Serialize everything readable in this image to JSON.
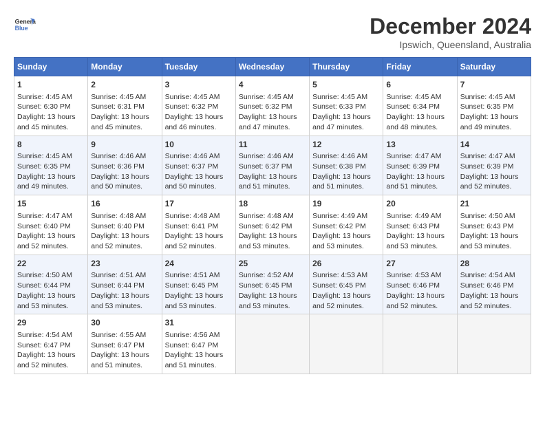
{
  "header": {
    "logo_line1": "General",
    "logo_line2": "Blue",
    "month": "December 2024",
    "location": "Ipswich, Queensland, Australia"
  },
  "weekdays": [
    "Sunday",
    "Monday",
    "Tuesday",
    "Wednesday",
    "Thursday",
    "Friday",
    "Saturday"
  ],
  "weeks": [
    [
      {
        "day": "1",
        "info": "Sunrise: 4:45 AM\nSunset: 6:30 PM\nDaylight: 13 hours\nand 45 minutes."
      },
      {
        "day": "2",
        "info": "Sunrise: 4:45 AM\nSunset: 6:31 PM\nDaylight: 13 hours\nand 45 minutes."
      },
      {
        "day": "3",
        "info": "Sunrise: 4:45 AM\nSunset: 6:32 PM\nDaylight: 13 hours\nand 46 minutes."
      },
      {
        "day": "4",
        "info": "Sunrise: 4:45 AM\nSunset: 6:32 PM\nDaylight: 13 hours\nand 47 minutes."
      },
      {
        "day": "5",
        "info": "Sunrise: 4:45 AM\nSunset: 6:33 PM\nDaylight: 13 hours\nand 47 minutes."
      },
      {
        "day": "6",
        "info": "Sunrise: 4:45 AM\nSunset: 6:34 PM\nDaylight: 13 hours\nand 48 minutes."
      },
      {
        "day": "7",
        "info": "Sunrise: 4:45 AM\nSunset: 6:35 PM\nDaylight: 13 hours\nand 49 minutes."
      }
    ],
    [
      {
        "day": "8",
        "info": "Sunrise: 4:45 AM\nSunset: 6:35 PM\nDaylight: 13 hours\nand 49 minutes."
      },
      {
        "day": "9",
        "info": "Sunrise: 4:46 AM\nSunset: 6:36 PM\nDaylight: 13 hours\nand 50 minutes."
      },
      {
        "day": "10",
        "info": "Sunrise: 4:46 AM\nSunset: 6:37 PM\nDaylight: 13 hours\nand 50 minutes."
      },
      {
        "day": "11",
        "info": "Sunrise: 4:46 AM\nSunset: 6:37 PM\nDaylight: 13 hours\nand 51 minutes."
      },
      {
        "day": "12",
        "info": "Sunrise: 4:46 AM\nSunset: 6:38 PM\nDaylight: 13 hours\nand 51 minutes."
      },
      {
        "day": "13",
        "info": "Sunrise: 4:47 AM\nSunset: 6:39 PM\nDaylight: 13 hours\nand 51 minutes."
      },
      {
        "day": "14",
        "info": "Sunrise: 4:47 AM\nSunset: 6:39 PM\nDaylight: 13 hours\nand 52 minutes."
      }
    ],
    [
      {
        "day": "15",
        "info": "Sunrise: 4:47 AM\nSunset: 6:40 PM\nDaylight: 13 hours\nand 52 minutes."
      },
      {
        "day": "16",
        "info": "Sunrise: 4:48 AM\nSunset: 6:40 PM\nDaylight: 13 hours\nand 52 minutes."
      },
      {
        "day": "17",
        "info": "Sunrise: 4:48 AM\nSunset: 6:41 PM\nDaylight: 13 hours\nand 52 minutes."
      },
      {
        "day": "18",
        "info": "Sunrise: 4:48 AM\nSunset: 6:42 PM\nDaylight: 13 hours\nand 53 minutes."
      },
      {
        "day": "19",
        "info": "Sunrise: 4:49 AM\nSunset: 6:42 PM\nDaylight: 13 hours\nand 53 minutes."
      },
      {
        "day": "20",
        "info": "Sunrise: 4:49 AM\nSunset: 6:43 PM\nDaylight: 13 hours\nand 53 minutes."
      },
      {
        "day": "21",
        "info": "Sunrise: 4:50 AM\nSunset: 6:43 PM\nDaylight: 13 hours\nand 53 minutes."
      }
    ],
    [
      {
        "day": "22",
        "info": "Sunrise: 4:50 AM\nSunset: 6:44 PM\nDaylight: 13 hours\nand 53 minutes."
      },
      {
        "day": "23",
        "info": "Sunrise: 4:51 AM\nSunset: 6:44 PM\nDaylight: 13 hours\nand 53 minutes."
      },
      {
        "day": "24",
        "info": "Sunrise: 4:51 AM\nSunset: 6:45 PM\nDaylight: 13 hours\nand 53 minutes."
      },
      {
        "day": "25",
        "info": "Sunrise: 4:52 AM\nSunset: 6:45 PM\nDaylight: 13 hours\nand 53 minutes."
      },
      {
        "day": "26",
        "info": "Sunrise: 4:53 AM\nSunset: 6:45 PM\nDaylight: 13 hours\nand 52 minutes."
      },
      {
        "day": "27",
        "info": "Sunrise: 4:53 AM\nSunset: 6:46 PM\nDaylight: 13 hours\nand 52 minutes."
      },
      {
        "day": "28",
        "info": "Sunrise: 4:54 AM\nSunset: 6:46 PM\nDaylight: 13 hours\nand 52 minutes."
      }
    ],
    [
      {
        "day": "29",
        "info": "Sunrise: 4:54 AM\nSunset: 6:47 PM\nDaylight: 13 hours\nand 52 minutes."
      },
      {
        "day": "30",
        "info": "Sunrise: 4:55 AM\nSunset: 6:47 PM\nDaylight: 13 hours\nand 51 minutes."
      },
      {
        "day": "31",
        "info": "Sunrise: 4:56 AM\nSunset: 6:47 PM\nDaylight: 13 hours\nand 51 minutes."
      },
      null,
      null,
      null,
      null
    ]
  ]
}
